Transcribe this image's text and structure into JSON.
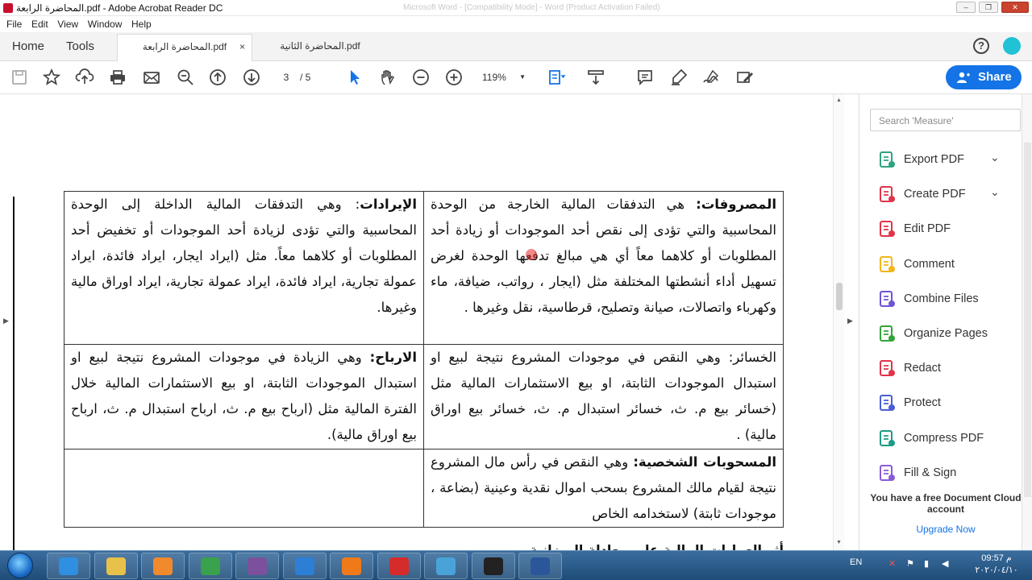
{
  "window": {
    "title": "المحاضرة الرابعة.pdf - Adobe Acrobat Reader DC",
    "background_window_title": "Microsoft Word - [Compatibility Mode] - Word (Product Activation Failed)",
    "controls": [
      "–",
      "❐",
      "✕"
    ]
  },
  "menu": [
    "File",
    "Edit",
    "View",
    "Window",
    "Help"
  ],
  "tabs": {
    "home": "Home",
    "tools": "Tools",
    "documents": [
      {
        "label": "المحاضرة الرابعة.pdf",
        "active": true
      },
      {
        "label": "المحاضرة الثانية.pdf",
        "active": false
      }
    ],
    "close_glyph": "×"
  },
  "toolbar": {
    "page_current": "3",
    "page_total": "/ 5",
    "zoom": "119%",
    "share_label": "Share",
    "icons": [
      "save-icon",
      "star-icon",
      "upload-icon",
      "print-icon",
      "mail-icon",
      "zoom-search-icon",
      "page-up-icon",
      "page-down-icon",
      "select-cursor-icon",
      "hand-icon",
      "zoom-out-icon",
      "zoom-in-icon",
      "fit-page-icon",
      "scroll-mode-icon",
      "comment-icon",
      "highlight-icon",
      "sign-icon",
      "fill-sign-icon"
    ]
  },
  "document": {
    "rows": [
      {
        "right": {
          "term": "المصروفات:",
          "text": " هي التدفقات المالية الخارجة من الوحدة المحاسبية والتي تؤدى إلى نقص أحد الموجودات أو زيادة أحد المطلوبات أو كلاهما معاً أي هي مبالغ تدفعها الوحدة لغرض تسهيل أداء أنشطتها المختلفة مثل (ايجار ، رواتب، ضيافة، ماء وكهرباء واتصالات، صيانة وتصليح، قرطاسية، نقل وغيرها ."
        },
        "left": {
          "term": "الإيرادات",
          "text": ": وهي التدفقات المالية الداخلة إلى الوحدة المحاسبية والتي تؤدى لزيادة أحد الموجودات أو تخفيض أحد المطلوبات أو كلاهما معاً. مثل (ايراد ايجار، ايراد فائدة، ايراد عمولة تجارية، ايراد فائدة، ايراد عمولة تجارية، ايراد اوراق مالية وغيرها."
        }
      },
      {
        "right": {
          "term": "",
          "text": "الخسائر: وهي النقص في موجودات المشروع نتيجة لبيع او استبدال الموجودات الثابتة، او بيع الاستثمارات المالية مثل (خسائر بيع م. ث، خسائر استبدال م. ث، خسائر بيع اوراق مالية) ."
        },
        "left": {
          "term": "الارباح:",
          "text": " وهي الزيادة في موجودات المشروع نتيجة لبيع او استبدال الموجودات الثابتة، او بيع الاستثمارات المالية خلال الفترة المالية مثل (ارباح بيع م. ث، ارباح استبدال م. ث، ارباح بيع اوراق مالية)."
        }
      },
      {
        "right": {
          "term": "المسحوبات الشخصية:",
          "text": " وهي النقص في رأس مال المشروع نتيجة لقيام مالك المشروع بسحب اموال نقدية وعينية (بضاعة ، موجودات ثابتة) لاستخدامه الخاص"
        },
        "left": {
          "term": "",
          "text": ""
        }
      }
    ],
    "cut_heading": "أثر العمليات المالية على معادلة الميزانية"
  },
  "sidebar": {
    "search_placeholder": "Search 'Measure'",
    "tools": [
      {
        "label": "Export PDF",
        "icon": "export-pdf-icon",
        "color": "#2fa37f",
        "expandable": true
      },
      {
        "label": "Create PDF",
        "icon": "create-pdf-icon",
        "color": "#e0344b",
        "expandable": true
      },
      {
        "label": "Edit PDF",
        "icon": "edit-pdf-icon",
        "color": "#e0344b",
        "expandable": false
      },
      {
        "label": "Comment",
        "icon": "comment-tool-icon",
        "color": "#f2b51b",
        "expandable": false
      },
      {
        "label": "Combine Files",
        "icon": "combine-files-icon",
        "color": "#6f54d6",
        "expandable": false
      },
      {
        "label": "Organize Pages",
        "icon": "organize-pages-icon",
        "color": "#34a23a",
        "expandable": false
      },
      {
        "label": "Redact",
        "icon": "redact-icon",
        "color": "#e0344b",
        "expandable": false
      },
      {
        "label": "Protect",
        "icon": "protect-icon",
        "color": "#4a5fd3",
        "expandable": false
      },
      {
        "label": "Compress PDF",
        "icon": "compress-pdf-icon",
        "color": "#1d9b85",
        "expandable": false
      },
      {
        "label": "Fill & Sign",
        "icon": "fill-sign-tool-icon",
        "color": "#8b5bd6",
        "expandable": false
      }
    ],
    "chevron": "⌄",
    "cloud_note": "You have a free Document Cloud account",
    "upgrade_label": "Upgrade Now"
  },
  "taskbar": {
    "apps": [
      {
        "name": "ie-icon",
        "color": "#2f8fe0"
      },
      {
        "name": "file-explorer-icon",
        "color": "#e8c14a"
      },
      {
        "name": "media-player-icon",
        "color": "#f08a2c"
      },
      {
        "name": "chrome-icon",
        "color": "#3aa14d"
      },
      {
        "name": "viber-icon",
        "color": "#7b519d"
      },
      {
        "name": "chrome-alt-icon",
        "color": "#2d7fd6"
      },
      {
        "name": "firefox-icon",
        "color": "#f07a1a"
      },
      {
        "name": "acrobat-icon",
        "color": "#d62b2b"
      },
      {
        "name": "photo-viewer-icon",
        "color": "#4aa3d8"
      },
      {
        "name": "recorder-icon",
        "color": "#222222"
      },
      {
        "name": "word-icon",
        "color": "#2b579a"
      }
    ],
    "lang": "EN",
    "time": "09:57 م",
    "date": "٢٠٢٠/٠٤/١٠"
  }
}
